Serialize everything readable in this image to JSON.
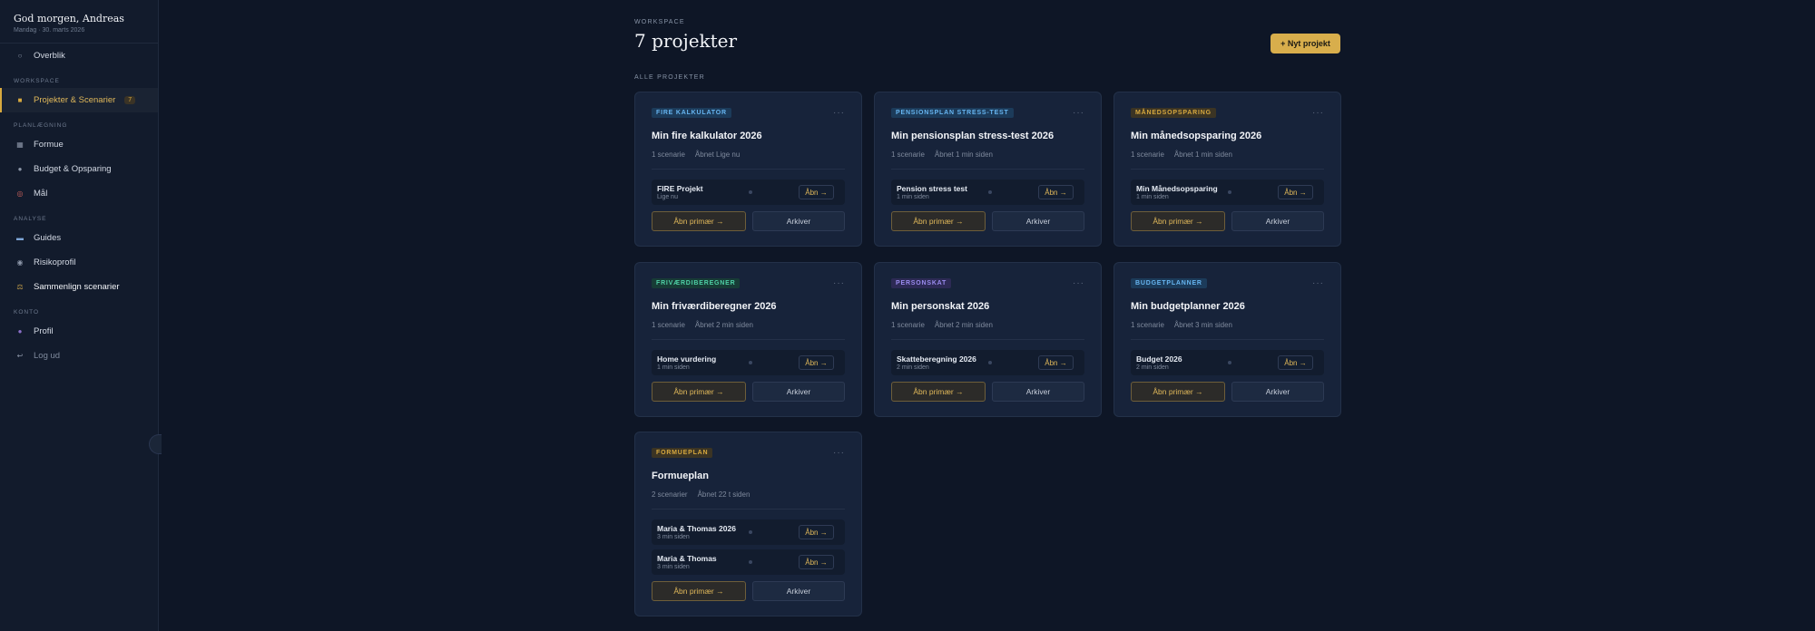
{
  "sidebar": {
    "greeting": "God morgen, Andreas",
    "date": "Mandag · 30. marts 2026",
    "overview": "Overblik",
    "sections": {
      "workspace": "WORKSPACE",
      "planning": "PLANLÆGNING",
      "analysis": "ANALYSE",
      "account": "KONTO"
    },
    "projects": {
      "label": "Projekter & Scenarier",
      "count": "7"
    },
    "items": {
      "wealth": "Formue",
      "budget": "Budget & Opsparing",
      "goals": "Mål",
      "guides": "Guides",
      "risk": "Risikoprofil",
      "compare": "Sammenlign scenarier",
      "profile": "Profil",
      "logout": "Log ud"
    }
  },
  "header": {
    "eyebrow": "WORKSPACE",
    "title": "7 projekter",
    "new_button": "+ Nyt projekt",
    "all_label": "ALLE PROJEKTER"
  },
  "card_labels": {
    "menu": "···",
    "open_small": "Åbn →",
    "open_primary": "Åbn primær →",
    "archive": "Arkiver"
  },
  "colors": {
    "accent": "#d8ae4c",
    "background": "#0e1626",
    "card": "#17233a"
  },
  "projects": [
    {
      "tag": "FIRE KALKULATOR",
      "title": "Min fire kalkulator 2026",
      "scenarios": "1 scenarie",
      "opened": "Åbnet Lige nu",
      "items": [
        {
          "name": "FIRE Projekt",
          "time": "Lige nu"
        }
      ]
    },
    {
      "tag": "PENSIONSPLAN STRESS-TEST",
      "title": "Min pensionsplan stress-test 2026",
      "scenarios": "1 scenarie",
      "opened": "Åbnet 1 min siden",
      "items": [
        {
          "name": "Pension stress test",
          "time": "1 min siden"
        }
      ]
    },
    {
      "tag": "MÅNEDSOPSPARING",
      "title": "Min månedsopsparing 2026",
      "scenarios": "1 scenarie",
      "opened": "Åbnet 1 min siden",
      "items": [
        {
          "name": "Min Månedsopsparing",
          "time": "1 min siden"
        }
      ]
    },
    {
      "tag": "FRIVÆRDIBEREGNER",
      "title": "Min friværdiberegner 2026",
      "scenarios": "1 scenarie",
      "opened": "Åbnet 2 min siden",
      "items": [
        {
          "name": "Home vurdering",
          "time": "1 min siden"
        }
      ]
    },
    {
      "tag": "PERSONSKAT",
      "title": "Min personskat 2026",
      "scenarios": "1 scenarie",
      "opened": "Åbnet 2 min siden",
      "items": [
        {
          "name": "Skatteberegning 2026",
          "time": "2 min siden"
        }
      ]
    },
    {
      "tag": "BUDGETPLANNER",
      "title": "Min budgetplanner 2026",
      "scenarios": "1 scenarie",
      "opened": "Åbnet 3 min siden",
      "items": [
        {
          "name": "Budget 2026",
          "time": "2 min siden"
        }
      ]
    },
    {
      "tag": "FORMUEPLAN",
      "title": "Formueplan",
      "scenarios": "2 scenarier",
      "opened": "Åbnet 22 t siden",
      "items": [
        {
          "name": "Maria & Thomas 2026",
          "time": "3 min siden"
        },
        {
          "name": "Maria & Thomas",
          "time": "3 min siden"
        }
      ]
    }
  ]
}
